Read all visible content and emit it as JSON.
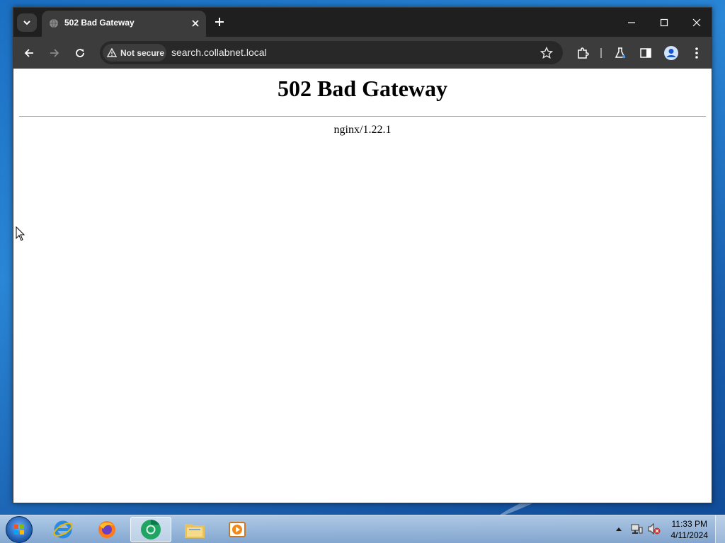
{
  "browser": {
    "tab": {
      "title": "502 Bad Gateway"
    },
    "address": {
      "security_label": "Not secure",
      "url": "search.collabnet.local"
    }
  },
  "page": {
    "heading": "502 Bad Gateway",
    "server_signature": "nginx/1.22.1"
  },
  "taskbar": {
    "apps": [
      {
        "name": "internet-explorer-icon"
      },
      {
        "name": "firefox-icon"
      },
      {
        "name": "chrome-icon",
        "active": true
      },
      {
        "name": "file-explorer-icon"
      },
      {
        "name": "media-player-icon"
      }
    ],
    "clock": {
      "time": "11:33 PM",
      "date": "4/11/2024"
    }
  },
  "colors": {
    "tabstrip": "#1f1f1f",
    "toolbar": "#3c3c3c",
    "omnibox": "#282828",
    "page_background": "#ffffff"
  }
}
